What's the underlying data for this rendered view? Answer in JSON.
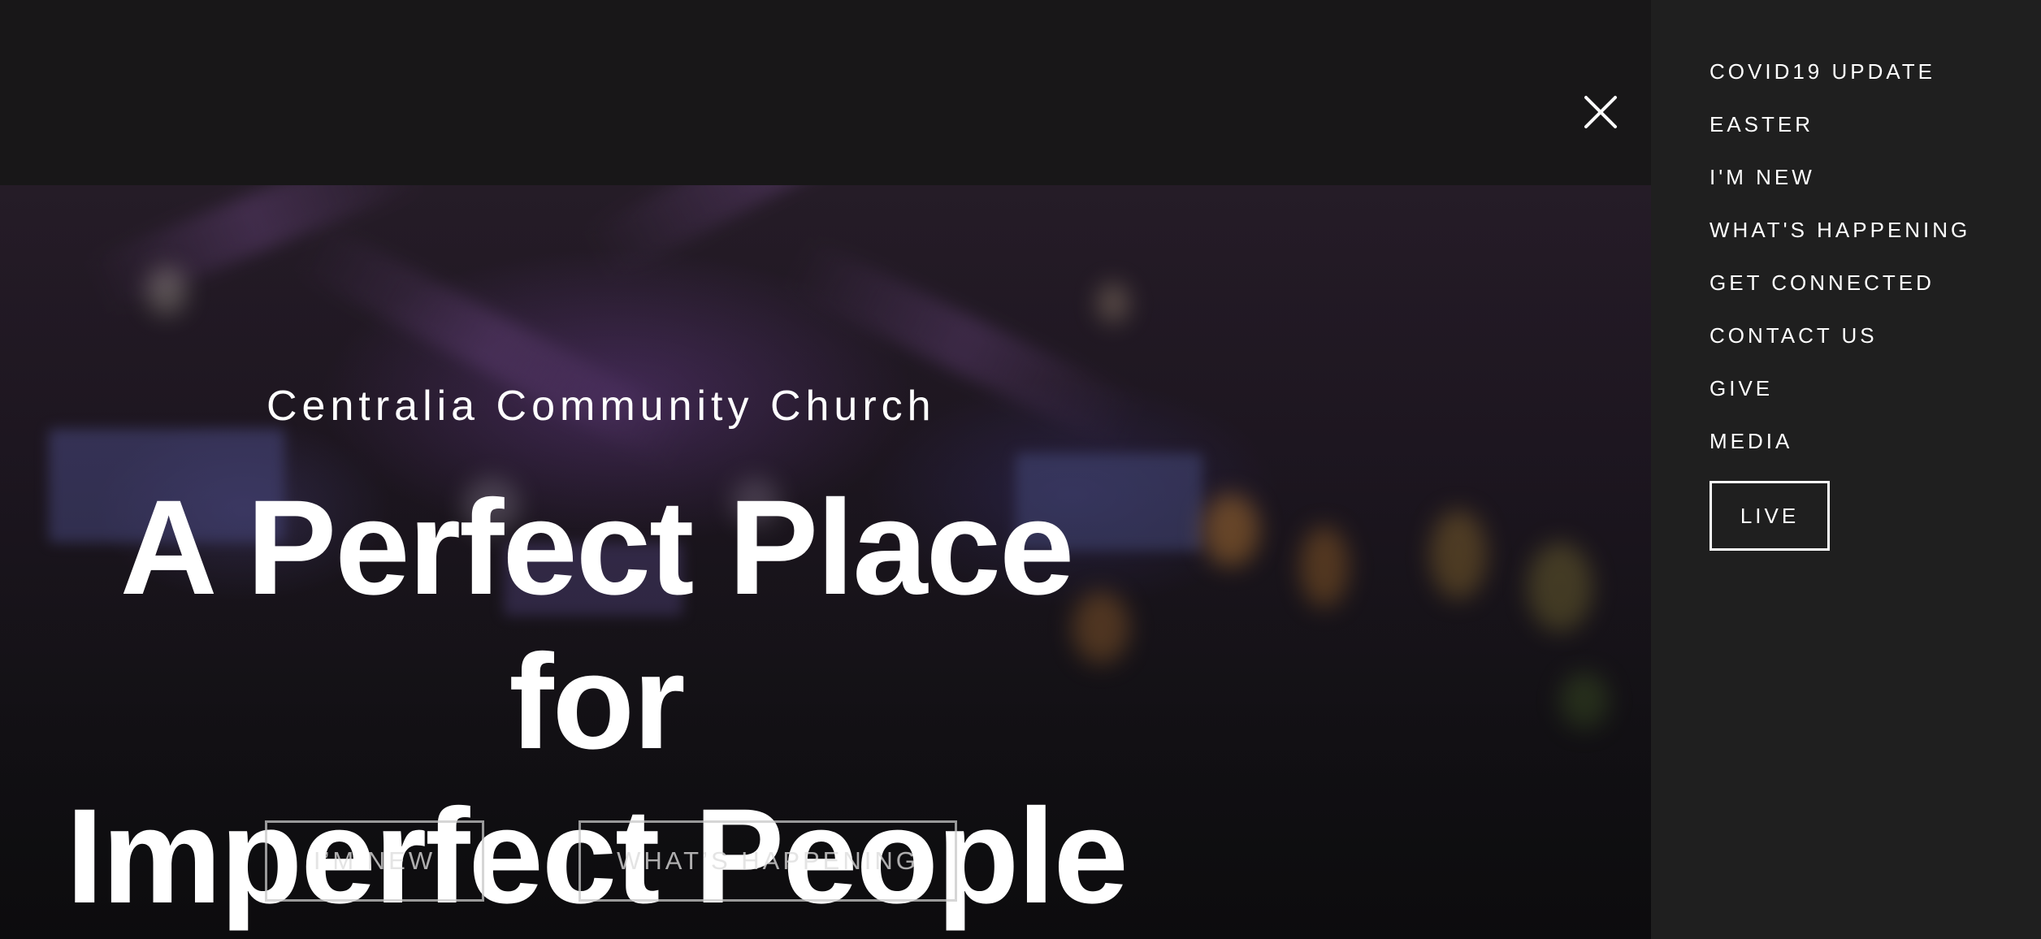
{
  "hero": {
    "church_name": "Centralia Community Church",
    "headline_line1": "A Perfect Place for",
    "headline_line2": "Imperfect People",
    "buttons": [
      {
        "label": "I’M NEW"
      },
      {
        "label": "WHAT’S HAPPENING"
      }
    ]
  },
  "nav": {
    "close_icon": "close-icon",
    "items": [
      {
        "label": "COVID19 UPDATE"
      },
      {
        "label": "EASTER"
      },
      {
        "label": "I'M NEW"
      },
      {
        "label": "WHAT'S HAPPENING"
      },
      {
        "label": "GET CONNECTED"
      },
      {
        "label": "CONTACT US"
      },
      {
        "label": "GIVE"
      },
      {
        "label": "MEDIA"
      }
    ],
    "live_label": "LIVE"
  },
  "colors": {
    "page_background": "#141314",
    "nav_background": "#1f1f1f",
    "text": "#ffffff",
    "button_border": "#c8c8c8"
  }
}
